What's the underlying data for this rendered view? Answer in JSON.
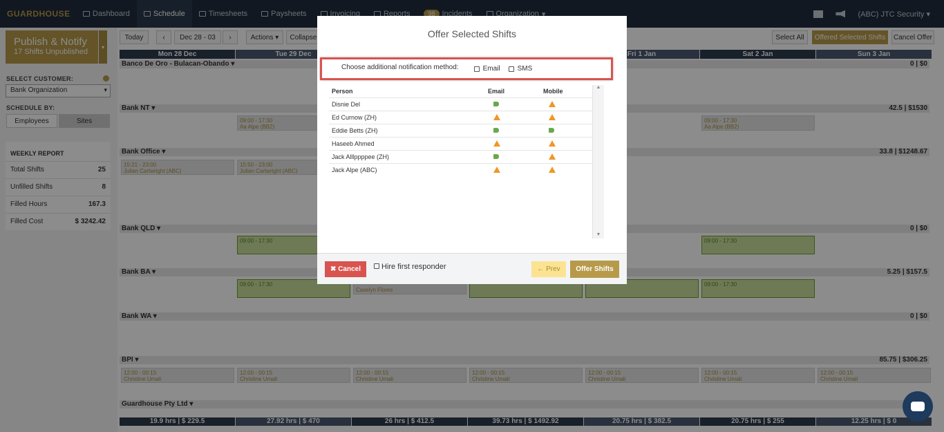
{
  "nav": {
    "logo": "GUARDHOUSE",
    "items": [
      "Dashboard",
      "Schedule",
      "Timesheets",
      "Paysheets",
      "Invoicing",
      "Reports",
      "Incidents",
      "Organization"
    ],
    "incident_count": "98",
    "account": "(ABC) JTC Security"
  },
  "sidebar": {
    "publish_title": "Publish & Notify",
    "publish_sub": "17 Shifts Unpublished",
    "select_customer_label": "SELECT CUSTOMER:",
    "customer_value": "Bank Organization",
    "schedule_by_label": "SCHEDULE BY:",
    "schedule_by": [
      "Employees",
      "Sites"
    ],
    "weekly_report_title": "WEEKLY REPORT",
    "report": [
      {
        "label": "Total Shifts",
        "value": "25"
      },
      {
        "label": "Unfilled Shifts",
        "value": "8"
      },
      {
        "label": "Filled Hours",
        "value": "167.3"
      },
      {
        "label": "Filled Cost",
        "value": "$ 3242.42"
      }
    ]
  },
  "toolbar": {
    "today": "Today",
    "date_range": "Dec 28 - 03",
    "actions": "Actions",
    "collapse": "Collapse",
    "select_all": "Select All",
    "offered_selected": "Offered Selected Shifts",
    "cancel_offer": "Cancel Offer"
  },
  "days": [
    "Mon 28 Dec",
    "Tue 29 Dec",
    "",
    "",
    "Fri 1 Jan",
    "Sat 2 Jan",
    "Sun 3 Jan"
  ],
  "groups": [
    {
      "name": "Banco De Oro - Bulacan-Obando",
      "total": "0 | $0"
    },
    {
      "name": "Bank NT",
      "total": "42.5 | $1530"
    },
    {
      "name": "Bank Office",
      "total": "33.8 | $1248.67"
    },
    {
      "name": "Bank QLD",
      "total": "0 | $0"
    },
    {
      "name": "Bank BA",
      "total": "5.25 | $157.5"
    },
    {
      "name": "Bank WA",
      "total": "0 | $0"
    },
    {
      "name": "BPI",
      "total": "85.75 | $306.25"
    },
    {
      "name": "Guardhouse Pty Ltd",
      "total": ""
    }
  ],
  "shifts": {
    "nt_time": "09:00 - 17:30",
    "nt_person": "Aa Alpe (BB2)",
    "office_mon_time": "15:21 - 23:00",
    "office_tue_time": "15:50 - 23:00",
    "office_person": "Julian Cartwright (ABC)",
    "qld_time": "09:00 - 17:30",
    "ba_time": "09:00 - 17:30",
    "ba_person": "Caselyn Flores",
    "bpi_time": "12:00 - 00:15",
    "bpi_person": "Christine Umali"
  },
  "totals": [
    "19.9 hrs   | $ 229.5",
    "27.92 hrs   | $ 470",
    "26 hrs   | $ 412.5",
    "39.73 hrs   | $ 1492.92",
    "20.75 hrs   | $ 382.5",
    "20.75 hrs   | $ 255",
    "12.25 hrs   | $ 0"
  ],
  "modal": {
    "title": "Offer Selected Shifts",
    "notify_label": "Choose additional notification method:",
    "email_option": "Email",
    "sms_option": "SMS",
    "columns": {
      "person": "Person",
      "email": "Email",
      "mobile": "Mobile"
    },
    "people": [
      {
        "name": "Disnie Del",
        "email": "ok",
        "mobile": "warn"
      },
      {
        "name": "Ed Curnow (ZH)",
        "email": "warn",
        "mobile": "warn"
      },
      {
        "name": "Eddie Betts (ZH)",
        "email": "ok",
        "mobile": "ok"
      },
      {
        "name": "Haseeb Ahmed",
        "email": "warn",
        "mobile": "warn"
      },
      {
        "name": "Jack Alllppppee (ZH)",
        "email": "ok",
        "mobile": "warn"
      },
      {
        "name": "Jack Alpe (ABC)",
        "email": "warn",
        "mobile": "warn"
      }
    ],
    "cancel": "Cancel",
    "hire_first": "Hire first responder",
    "prev": "Prev",
    "offer": "Offer Shifts"
  },
  "colors": {
    "accent": "#b69a4a",
    "nav": "#1f2d3d",
    "danger": "#d9534f",
    "ok": "#6aa84f",
    "warn": "#f0962a"
  }
}
